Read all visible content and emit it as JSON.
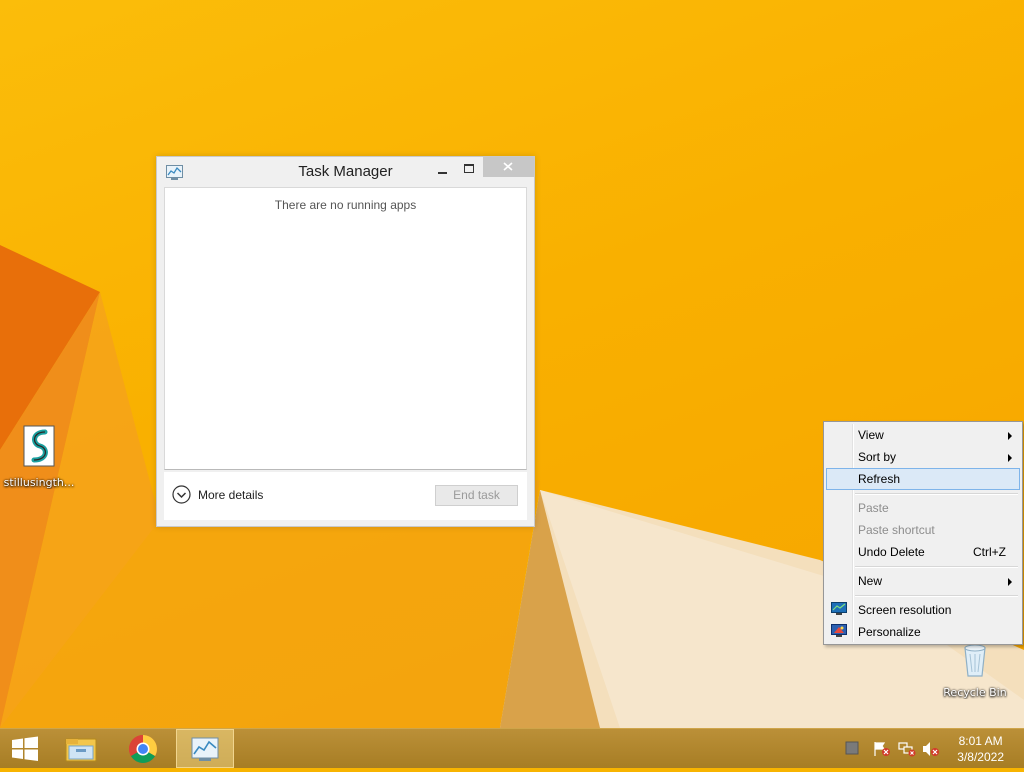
{
  "desktop": {
    "icons": [
      {
        "label": "stillusingth...",
        "icon": "script-file-icon"
      },
      {
        "label": "Recycle Bin",
        "icon": "recycle-bin-icon"
      }
    ]
  },
  "task_manager": {
    "title": "Task Manager",
    "empty_message": "There are no running apps",
    "more_details_label": "More details",
    "end_task_label": "End task"
  },
  "context_menu": {
    "items": [
      {
        "label": "View",
        "submenu": true
      },
      {
        "label": "Sort by",
        "submenu": true
      },
      {
        "label": "Refresh",
        "highlighted": true
      },
      {
        "label": "Paste",
        "disabled": true
      },
      {
        "label": "Paste shortcut",
        "disabled": true
      },
      {
        "label": "Undo Delete",
        "shortcut": "Ctrl+Z"
      },
      {
        "label": "New",
        "submenu": true
      },
      {
        "label": "Screen resolution",
        "icon": "monitor-icon"
      },
      {
        "label": "Personalize",
        "icon": "personalize-icon"
      }
    ]
  },
  "taskbar": {
    "apps": [
      "start-button",
      "file-explorer",
      "chrome",
      "task-manager"
    ],
    "clock": {
      "time": "8:01 AM",
      "date": "3/8/2022"
    }
  },
  "colors": {
    "desktop_bg": "#f9b000",
    "taskbar_bg": "#b0862c",
    "menu_highlight": "#dbe9f7"
  }
}
